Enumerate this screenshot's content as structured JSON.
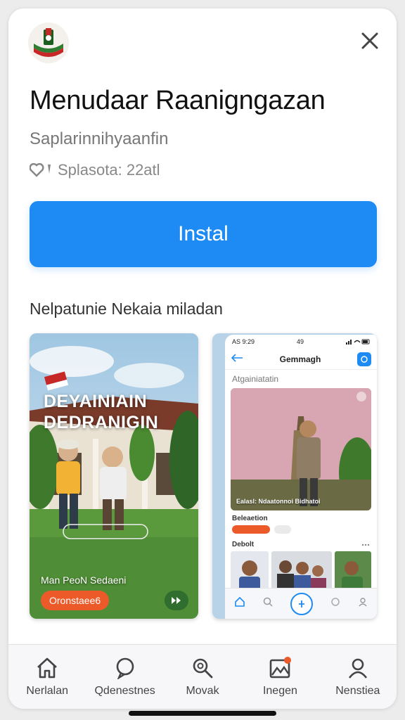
{
  "app": {
    "title": "Menudaar Raanigngazan",
    "subtitle": "Saplarinnihyaanfin",
    "meta_text": "Splasota: 22atl",
    "meta_icon": "heart-icon"
  },
  "install": {
    "label": "Instal"
  },
  "section": {
    "title": "Nelpatunie Nekaia miladan"
  },
  "screenshot_1": {
    "overlay_title": "DEYAINIAIN DEDRANIGIN",
    "caption": "Man PeoN Sedaeni",
    "cta_label": "Oronstaee6"
  },
  "screenshot_2": {
    "time": "AS 9:29",
    "center_status": "49",
    "nav_title": "Gemmagh",
    "sub_heading": "Atgainiatatin",
    "hero_caption": "Ealasl: Ndaatonnoi Bidhatoi",
    "section_label": "Beleaetion",
    "row_label": "Debolt"
  },
  "bottom_nav": {
    "tabs": [
      {
        "label": "Nerlalan",
        "icon": "home-icon"
      },
      {
        "label": "Qdenestnes",
        "icon": "chat-bubble-icon"
      },
      {
        "label": "Movak",
        "icon": "search-icon"
      },
      {
        "label": "Inegen",
        "icon": "image-icon"
      },
      {
        "label": "Nenstiea",
        "icon": "profile-icon"
      }
    ]
  },
  "colors": {
    "accent": "#1d8bf3",
    "cta": "#ec5a2a",
    "green": "#2f6e2e"
  }
}
